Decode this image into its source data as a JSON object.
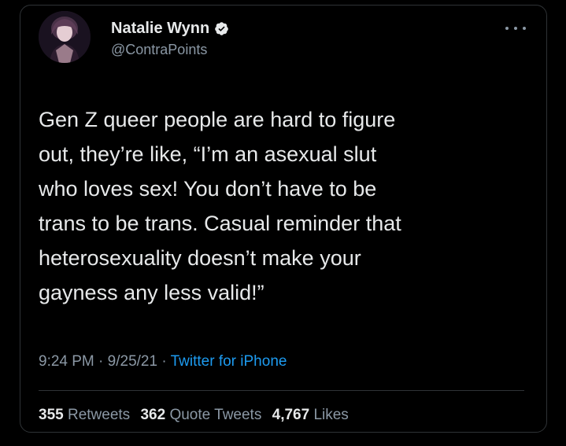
{
  "author": {
    "display_name": "Natalie Wynn",
    "handle": "@ContraPoints",
    "verified_icon": "verified-badge-icon",
    "avatar_icon": "avatar-photo"
  },
  "more_icon": "more-options-icon",
  "tweet": {
    "text": "Gen Z queer people are hard to figure\nout, they’re like, “I’m an asexual slut\nwho loves sex! You don’t have to be\ntrans to be trans. Casual reminder that\nheterosexuality doesn’t make your\ngayness any less valid!”"
  },
  "meta": {
    "time": "9:24 PM",
    "sep1": " · ",
    "date": "9/25/21",
    "sep2": " · ",
    "source": "Twitter for iPhone"
  },
  "stats": {
    "retweets_count": "355",
    "retweets_label": "Retweets",
    "quotes_count": "362",
    "quotes_label": "Quote Tweets",
    "likes_count": "4,767",
    "likes_label": "Likes"
  },
  "colors": {
    "background": "#000000",
    "text_primary": "#e7e9ea",
    "text_secondary": "#8b98a5",
    "link": "#1d9bf0",
    "border": "#2f3336"
  }
}
